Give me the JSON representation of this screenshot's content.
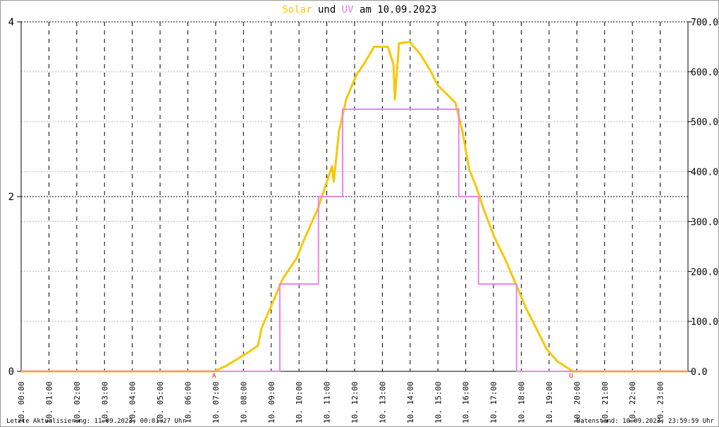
{
  "title": {
    "solar": "Solar",
    "und": "und",
    "uv": "UV",
    "rest": "am 10.09.2023"
  },
  "footer": {
    "left": "Letzte Aktualisierung: 11.09.2023, 00:01:27 Uhr",
    "right": "Datenstand: 10.09.2023, 23:59:59 Uhr"
  },
  "colors": {
    "solar": "#f5c800",
    "uv": "#ee82ee",
    "marker": "#ff0000"
  },
  "chart_data": {
    "type": "line",
    "title": "Solar und UV am 10.09.2023",
    "x_unit": "hour of day",
    "xlim": [
      0,
      24
    ],
    "x_tick_labels": [
      "10. 00:00",
      "10. 01:00",
      "10. 02:00",
      "10. 03:00",
      "10. 04:00",
      "10. 05:00",
      "10. 06:00",
      "10. 07:00",
      "10. 08:00",
      "10. 09:00",
      "10. 10:00",
      "10. 11:00",
      "10. 12:00",
      "10. 13:00",
      "10. 14:00",
      "10. 15:00",
      "10. 16:00",
      "10. 17:00",
      "10. 18:00",
      "10. 19:00",
      "10. 20:00",
      "10. 21:00",
      "10. 22:00",
      "10. 23:00"
    ],
    "y_left": {
      "lim": [
        0,
        4
      ],
      "ticks": [
        "0",
        "2",
        "4"
      ]
    },
    "y_right": {
      "lim": [
        0,
        700
      ],
      "ticks": [
        "0.0",
        "100.0",
        "200.0",
        "300.0",
        "400.0",
        "500.0",
        "600.0",
        "700.0"
      ]
    },
    "markers": [
      {
        "label": "A",
        "x": 6.95
      },
      {
        "label": "U",
        "x": 19.8
      }
    ],
    "series": [
      {
        "name": "Solar",
        "axis": "right",
        "points": [
          [
            0,
            0
          ],
          [
            6.95,
            0
          ],
          [
            7.38,
            11
          ],
          [
            8.14,
            37
          ],
          [
            8.52,
            51
          ],
          [
            8.65,
            86
          ],
          [
            9.03,
            135
          ],
          [
            9.41,
            185
          ],
          [
            9.92,
            227
          ],
          [
            10.17,
            262
          ],
          [
            10.68,
            326
          ],
          [
            11.19,
            411
          ],
          [
            11.25,
            380
          ],
          [
            11.44,
            481
          ],
          [
            11.7,
            545
          ],
          [
            12.07,
            594
          ],
          [
            12.33,
            615
          ],
          [
            12.7,
            650
          ],
          [
            13.2,
            650
          ],
          [
            13.4,
            615
          ],
          [
            13.45,
            545
          ],
          [
            13.6,
            657
          ],
          [
            13.98,
            660
          ],
          [
            14.36,
            636
          ],
          [
            14.74,
            601
          ],
          [
            14.99,
            573
          ],
          [
            15.25,
            559
          ],
          [
            15.63,
            538
          ],
          [
            15.88,
            481
          ],
          [
            16.13,
            404
          ],
          [
            16.39,
            368
          ],
          [
            16.64,
            326
          ],
          [
            17.02,
            270
          ],
          [
            17.4,
            227
          ],
          [
            17.78,
            178
          ],
          [
            18.16,
            128
          ],
          [
            18.54,
            86
          ],
          [
            18.92,
            44
          ],
          [
            19.3,
            20
          ],
          [
            19.69,
            6
          ],
          [
            19.86,
            0
          ],
          [
            24,
            0
          ]
        ]
      },
      {
        "name": "UV",
        "axis": "left",
        "step": true,
        "points": [
          [
            0,
            0
          ],
          [
            9.31,
            1
          ],
          [
            10.7,
            2
          ],
          [
            11.57,
            3
          ],
          [
            15.75,
            2
          ],
          [
            16.46,
            1
          ],
          [
            17.83,
            0
          ],
          [
            24,
            0
          ]
        ]
      }
    ]
  }
}
